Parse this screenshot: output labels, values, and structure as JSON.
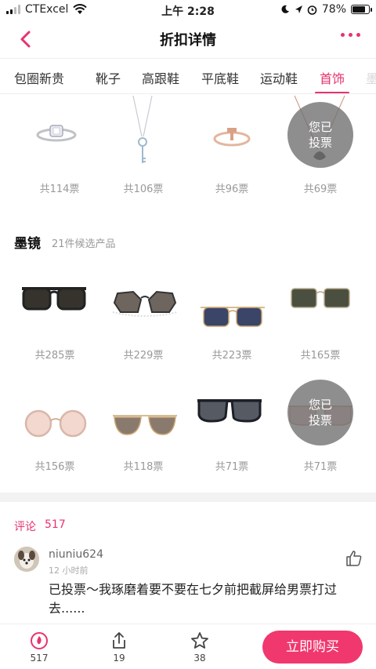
{
  "status_bar": {
    "carrier": "CTExcel",
    "time": "上午 2:28",
    "battery": "78%",
    "battery_level": 0.78
  },
  "nav": {
    "title": "折扣详情"
  },
  "tabs": [
    {
      "label": "包圈新贵"
    },
    {
      "label": "靴子"
    },
    {
      "label": "高跟鞋"
    },
    {
      "label": "平底鞋"
    },
    {
      "label": "运动鞋"
    },
    {
      "label": "首饰",
      "active": true
    },
    {
      "label": "墨"
    }
  ],
  "jewelry": {
    "items": [
      {
        "name": "ring-diamond",
        "votes": "共114票"
      },
      {
        "name": "necklace-key",
        "votes": "共106票"
      },
      {
        "name": "ring-t",
        "votes": "共96票"
      },
      {
        "name": "necklace-swan",
        "votes": "共69票",
        "voted": true
      }
    ]
  },
  "sunglasses": {
    "title": "墨镜",
    "count": "21件候选产品",
    "items": [
      {
        "votes": "共285票"
      },
      {
        "votes": "共229票"
      },
      {
        "votes": "共223票"
      },
      {
        "votes": "共165票"
      },
      {
        "votes": "共156票"
      },
      {
        "votes": "共118票"
      },
      {
        "votes": "共71票"
      },
      {
        "votes": "共71票",
        "voted": true
      }
    ]
  },
  "voted_badge": {
    "line1": "您已",
    "line2": "投票"
  },
  "comments": {
    "label": "评论",
    "count": "517",
    "items": [
      {
        "user": "niuniu624",
        "time": "12 小时前",
        "text": "已投票～我琢磨着要不要在七夕前把截屏给男票打过去......"
      }
    ]
  },
  "bottom_bar": {
    "votes": "517",
    "share": "19",
    "favorites": "38",
    "buy_label": "立即购买"
  },
  "colors": {
    "accent": "#e8336d",
    "buy_button": "#f0386e"
  }
}
